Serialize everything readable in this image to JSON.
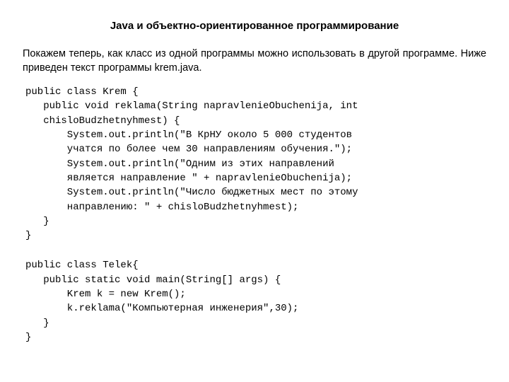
{
  "title": "Java и объектно-ориентированное программирование",
  "intro": "Покажем теперь, как класс из одной программы можно использовать в другой программе. Ниже приведен текст программы krem.java.",
  "code1": "public class Krem {\n   public void reklama(String napravlenieObuchenija, int\n   chisloBudzhetnyhmest) {\n       System.out.println(\"В КрНУ около 5 000 студентов\n       учатся по более чем 30 направлениям обучения.\");\n       System.out.println(\"Одним из этих направлений\n       является направление \" + napravlenieObuchenija);\n       System.out.println(\"Число бюджетных мест по этому\n       направлению: \" + chisloBudzhetnyhmest);\n   }\n}",
  "code2": "public class Telek{\n   public static void main(String[] args) {\n       Krem k = new Krem();\n       k.reklama(\"Компьютерная инженерия\",30);\n   }\n}"
}
